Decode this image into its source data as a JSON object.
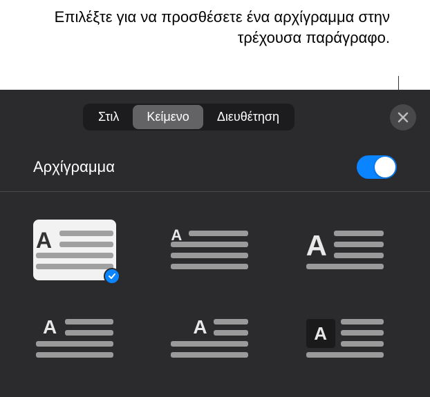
{
  "annotation": "Επιλέξτε για να προσθέσετε ένα αρχίγραμμα στην τρέχουσα παράγραφο.",
  "tabs": {
    "style": "Στιλ",
    "text": "Κείμενο",
    "arrangement": "Διευθέτηση"
  },
  "section": {
    "title": "Αρχίγραμμα",
    "toggle_on": true
  },
  "options": {
    "selected_index": 0,
    "glyph": "A"
  }
}
